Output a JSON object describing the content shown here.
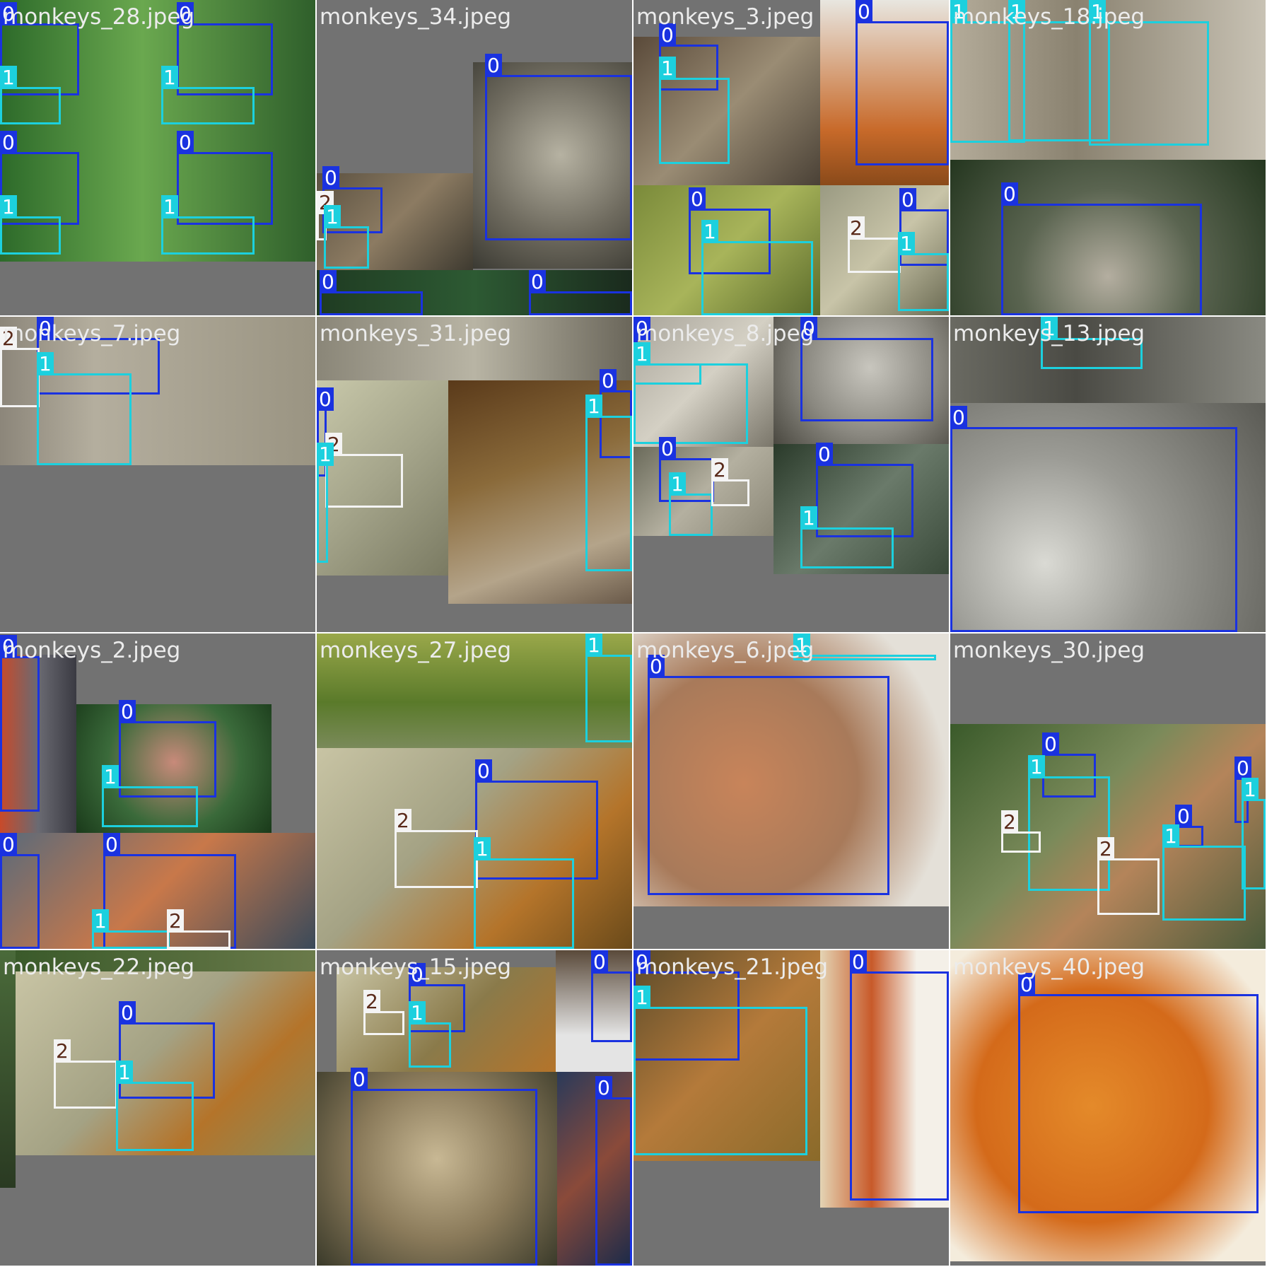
{
  "colors": {
    "class_0": "#1a32e0",
    "class_1": "#1cd0de",
    "class_2": "#f4f4f4",
    "background": "#727272",
    "filename_text": "#ececec"
  },
  "tiles": [
    {
      "filename": "monkeys_28.jpeg",
      "photos": [
        {
          "r": [
            0,
            0,
            446,
            370
          ],
          "bg": "linear-gradient(90deg,#2d6a2a,#6aa84f 45%,#2f5f2b)"
        }
      ],
      "boxes": [
        {
          "c": 0,
          "r": [
            0,
            33,
            112,
            135
          ]
        },
        {
          "c": 1,
          "r": [
            0,
            123,
            86,
            176
          ]
        },
        {
          "c": 0,
          "r": [
            250,
            33,
            386,
            135
          ]
        },
        {
          "c": 1,
          "r": [
            228,
            123,
            360,
            176
          ]
        },
        {
          "c": 0,
          "r": [
            0,
            215,
            112,
            318
          ]
        },
        {
          "c": 1,
          "r": [
            0,
            306,
            86,
            360
          ]
        },
        {
          "c": 0,
          "r": [
            250,
            215,
            386,
            318
          ]
        },
        {
          "c": 1,
          "r": [
            228,
            306,
            360,
            360
          ]
        }
      ]
    },
    {
      "filename": "monkeys_34.jpeg",
      "photos": [
        {
          "r": [
            221,
            88,
            446,
            380
          ],
          "bg": "radial-gradient(circle at 55% 45%,#b6b2a2,#6f6b5f 55%,#3b3a33)"
        },
        {
          "r": [
            0,
            245,
            221,
            382
          ],
          "bg": "linear-gradient(135deg,#5b5141,#8c7b62,#3e3a30)"
        },
        {
          "r": [
            0,
            382,
            446,
            446
          ],
          "bg": "linear-gradient(90deg,#1f3b22,#2d5a33,#1a2a1d)"
        }
      ],
      "boxes": [
        {
          "c": 0,
          "r": [
            238,
            106,
            446,
            340
          ]
        },
        {
          "c": 0,
          "r": [
            8,
            265,
            93,
            330
          ]
        },
        {
          "c": 2,
          "r": [
            0,
            300,
            14,
            340
          ]
        },
        {
          "c": 1,
          "r": [
            10,
            320,
            74,
            380
          ]
        },
        {
          "c": 0,
          "r": [
            4,
            412,
            150,
            446
          ]
        },
        {
          "c": 0,
          "r": [
            300,
            412,
            446,
            446
          ]
        }
      ]
    },
    {
      "filename": "monkeys_3.jpeg",
      "photos": [
        {
          "r": [
            0,
            52,
            264,
            262
          ],
          "bg": "linear-gradient(135deg,#5a4a3a,#9a8c74 50%,#4a4136)"
        },
        {
          "r": [
            264,
            0,
            446,
            262
          ],
          "bg": "linear-gradient(180deg,#e8e6e0,#c86a2a 70%,#8a4a1a)"
        },
        {
          "r": [
            0,
            262,
            264,
            446
          ],
          "bg": "linear-gradient(135deg,#7a8a3a,#a8b45a,#5a6a2a)"
        },
        {
          "r": [
            264,
            262,
            446,
            446
          ],
          "bg": "linear-gradient(135deg,#9a9a82,#c8c4a8,#6a6a52)"
        }
      ],
      "boxes": [
        {
          "c": 0,
          "r": [
            36,
            63,
            120,
            128
          ]
        },
        {
          "c": 1,
          "r": [
            36,
            110,
            136,
            232
          ]
        },
        {
          "c": 0,
          "r": [
            314,
            4,
            446,
            234
          ]
        },
        {
          "c": 0,
          "r": [
            78,
            295,
            194,
            388
          ]
        },
        {
          "c": 1,
          "r": [
            96,
            341,
            254,
            446
          ]
        },
        {
          "c": 2,
          "r": [
            303,
            336,
            378,
            386
          ]
        },
        {
          "c": 0,
          "r": [
            376,
            296,
            446,
            376
          ]
        },
        {
          "c": 1,
          "r": [
            374,
            358,
            446,
            440
          ]
        }
      ]
    },
    {
      "filename": "monkeys_18.jpeg",
      "photos": [
        {
          "r": [
            0,
            0,
            446,
            226
          ],
          "bg": "linear-gradient(90deg,#b4ac9a,#8a8270 40%,#c8c2b4)"
        },
        {
          "r": [
            0,
            226,
            446,
            446
          ],
          "bg": "radial-gradient(circle at 50% 75%,#b4aea0,#5a6450 45%,#24361f)"
        }
      ],
      "boxes": [
        {
          "c": 1,
          "r": [
            0,
            4,
            106,
            202
          ]
        },
        {
          "c": 1,
          "r": [
            82,
            4,
            226,
            200
          ]
        },
        {
          "c": 1,
          "r": [
            196,
            4,
            366,
            206
          ]
        },
        {
          "c": 0,
          "r": [
            72,
            288,
            356,
            446
          ]
        }
      ]
    },
    {
      "filename": "monkeys_7.jpeg",
      "photos": [
        {
          "r": [
            0,
            0,
            446,
            210
          ],
          "bg": "linear-gradient(90deg,#8c867a,#b4ae9e 30%,#9a9482)"
        }
      ],
      "boxes": [
        {
          "c": 0,
          "r": [
            52,
            0,
            226,
            110
          ]
        },
        {
          "c": 2,
          "r": [
            0,
            44,
            56,
            128
          ]
        },
        {
          "c": 1,
          "r": [
            52,
            80,
            186,
            210
          ]
        }
      ]
    },
    {
      "filename": "monkeys_31.jpeg",
      "photos": [
        {
          "r": [
            0,
            0,
            446,
            90
          ],
          "bg": "linear-gradient(90deg,#8a8678,#b8b4a4,#6a665a)"
        },
        {
          "r": [
            0,
            90,
            186,
            366
          ],
          "bg": "linear-gradient(135deg,#c8c8aa,#a4a48a,#7a7a62)"
        },
        {
          "r": [
            186,
            90,
            446,
            406
          ],
          "bg": "linear-gradient(160deg,#5a3a1a,#8a6a3a 40%,#b4a48a 75%,#6a5a4a)"
        }
      ],
      "boxes": [
        {
          "c": 0,
          "r": [
            0,
            130,
            14,
            226
          ]
        },
        {
          "c": 2,
          "r": [
            12,
            194,
            122,
            270
          ]
        },
        {
          "c": 1,
          "r": [
            0,
            208,
            16,
            348
          ]
        },
        {
          "c": 0,
          "r": [
            400,
            104,
            446,
            200
          ]
        },
        {
          "c": 1,
          "r": [
            380,
            140,
            446,
            360
          ]
        }
      ]
    },
    {
      "filename": "monkeys_8.jpeg",
      "photos": [
        {
          "r": [
            0,
            0,
            198,
            184
          ],
          "bg": "linear-gradient(135deg,#a8a49a,#d4d0c4,#7a766a)"
        },
        {
          "r": [
            198,
            0,
            446,
            180
          ],
          "bg": "radial-gradient(circle at 55% 40%,#c8c6be,#8a8880 55%,#4a4840)"
        },
        {
          "r": [
            0,
            184,
            198,
            310
          ],
          "bg": "linear-gradient(135deg,#6a6a5a,#b4b0a0,#8a8676)"
        },
        {
          "r": [
            198,
            180,
            446,
            364
          ],
          "bg": "linear-gradient(135deg,#2a3a2a,#6a7a6a,#3a4a3a)"
        }
      ],
      "boxes": [
        {
          "c": 0,
          "r": [
            0,
            0,
            6,
            50
          ]
        },
        {
          "c": 0,
          "r": [
            236,
            0,
            424,
            148
          ]
        },
        {
          "c": 1,
          "r": [
            0,
            66,
            96,
            96
          ]
        },
        {
          "c": 1,
          "r": [
            0,
            66,
            162,
            180
          ]
        },
        {
          "c": 0,
          "r": [
            36,
            200,
            114,
            262
          ]
        },
        {
          "c": 1,
          "r": [
            50,
            250,
            112,
            310
          ]
        },
        {
          "c": 2,
          "r": [
            110,
            230,
            164,
            268
          ]
        },
        {
          "c": 0,
          "r": [
            258,
            208,
            396,
            312
          ]
        },
        {
          "c": 1,
          "r": [
            236,
            298,
            368,
            356
          ]
        }
      ]
    },
    {
      "filename": "monkeys_13.jpeg",
      "photos": [
        {
          "r": [
            0,
            0,
            446,
            122
          ],
          "bg": "linear-gradient(90deg,#6a6a62,#4a4a44 40%,#8a8a82)"
        },
        {
          "r": [
            0,
            122,
            446,
            446
          ],
          "bg": "radial-gradient(circle at 30% 70%,#dadad4,#9a9a94 40%,#5a5a54)"
        }
      ],
      "boxes": [
        {
          "c": 1,
          "r": [
            128,
            6,
            272,
            74
          ]
        },
        {
          "c": 0,
          "r": [
            0,
            156,
            406,
            446
          ]
        }
      ]
    },
    {
      "filename": "monkeys_2.jpeg",
      "photos": [
        {
          "r": [
            0,
            30,
            108,
            282
          ],
          "bg": "linear-gradient(90deg,#c84a2a,#6a6a72,#3a3a42)"
        },
        {
          "r": [
            108,
            100,
            384,
            282
          ],
          "bg": "radial-gradient(circle at 50% 45%,#c88a7a,#3a6a3a 55%,#1a3a1a)"
        },
        {
          "r": [
            0,
            282,
            446,
            446
          ],
          "bg": "linear-gradient(135deg,#5a6a7a,#c8784a 50%,#3a4a5a)"
        }
      ],
      "boxes": [
        {
          "c": 0,
          "r": [
            0,
            32,
            56,
            252
          ]
        },
        {
          "c": 0,
          "r": [
            168,
            124,
            306,
            232
          ]
        },
        {
          "c": 1,
          "r": [
            144,
            216,
            280,
            274
          ]
        },
        {
          "c": 0,
          "r": [
            0,
            312,
            56,
            446
          ]
        },
        {
          "c": 0,
          "r": [
            146,
            312,
            334,
            446
          ]
        },
        {
          "c": 1,
          "r": [
            130,
            420,
            240,
            446
          ]
        },
        {
          "c": 2,
          "r": [
            236,
            420,
            326,
            446
          ]
        }
      ]
    },
    {
      "filename": "monkeys_27.jpeg",
      "photos": [
        {
          "r": [
            0,
            0,
            446,
            162
          ],
          "bg": "linear-gradient(180deg,#9aa84a,#5a7a2a 60%,#7a8a5a)"
        },
        {
          "r": [
            0,
            162,
            446,
            446
          ],
          "bg": "linear-gradient(135deg,#c8c4a4,#a4a284 40%,#b4742a 70%,#6a4a1a)"
        }
      ],
      "boxes": [
        {
          "c": 1,
          "r": [
            380,
            0,
            446,
            154
          ]
        },
        {
          "c": 0,
          "r": [
            224,
            208,
            398,
            348
          ]
        },
        {
          "c": 2,
          "r": [
            110,
            278,
            228,
            360
          ]
        },
        {
          "c": 1,
          "r": [
            222,
            318,
            364,
            446
          ]
        }
      ]
    },
    {
      "filename": "monkeys_6.jpeg",
      "photos": [
        {
          "r": [
            0,
            0,
            446,
            386
          ],
          "bg": "radial-gradient(circle at 35% 55%,#c8845a,#a87a5a 45%,#e4e0d8 80%)"
        }
      ],
      "boxes": [
        {
          "c": 1,
          "r": [
            226,
            0,
            428,
            38
          ]
        },
        {
          "c": 0,
          "r": [
            20,
            60,
            362,
            370
          ]
        }
      ]
    },
    {
      "filename": "monkeys_30.jpeg",
      "photos": [
        {
          "r": [
            0,
            128,
            446,
            446
          ],
          "bg": "linear-gradient(135deg,#3a5a2a,#7a8a5a 40%,#b4845a 60%,#4a5a3a)"
        }
      ],
      "boxes": [
        {
          "c": 0,
          "r": [
            130,
            170,
            206,
            232
          ]
        },
        {
          "c": 1,
          "r": [
            110,
            202,
            226,
            364
          ]
        },
        {
          "c": 2,
          "r": [
            72,
            280,
            128,
            310
          ]
        },
        {
          "c": 2,
          "r": [
            208,
            318,
            296,
            398
          ]
        },
        {
          "c": 0,
          "r": [
            402,
            204,
            422,
            268
          ]
        },
        {
          "c": 1,
          "r": [
            412,
            234,
            446,
            362
          ]
        },
        {
          "c": 0,
          "r": [
            318,
            272,
            358,
            302
          ]
        },
        {
          "c": 1,
          "r": [
            300,
            300,
            418,
            406
          ]
        }
      ]
    },
    {
      "filename": "monkeys_22.jpeg",
      "photos": [
        {
          "r": [
            0,
            0,
            22,
            336
          ],
          "bg": "linear-gradient(180deg,#4a6a3a,#2a3a22)"
        },
        {
          "r": [
            22,
            30,
            446,
            290
          ],
          "bg": "linear-gradient(135deg,#c8c4a4,#a4a284 45%,#b4742a 70%,#8a8a5a)"
        },
        {
          "r": [
            22,
            0,
            446,
            30
          ],
          "bg": "linear-gradient(90deg,#3a5a2a,#6a7a4a)"
        }
      ],
      "boxes": [
        {
          "c": 0,
          "r": [
            168,
            102,
            304,
            210
          ]
        },
        {
          "c": 2,
          "r": [
            76,
            156,
            166,
            224
          ]
        },
        {
          "c": 1,
          "r": [
            164,
            186,
            274,
            284
          ]
        }
      ]
    },
    {
      "filename": "monkeys_15.jpeg",
      "photos": [
        {
          "r": [
            28,
            24,
            338,
            172
          ],
          "bg": "linear-gradient(135deg,#c8c4a4,#8a7a4a 55%,#b4742a)"
        },
        {
          "r": [
            338,
            0,
            446,
            172
          ],
          "bg": "linear-gradient(180deg,#5a4a3a,#e4e4e4 70%)"
        },
        {
          "r": [
            0,
            172,
            340,
            446
          ],
          "bg": "radial-gradient(circle at 50% 45%,#c8b894,#8a7a5a 50%,#3a3a2a)"
        },
        {
          "r": [
            340,
            172,
            446,
            446
          ],
          "bg": "linear-gradient(135deg,#2a3a5a,#8a4a3a,#1a2a4a)"
        }
      ],
      "boxes": [
        {
          "c": 0,
          "r": [
            130,
            48,
            210,
            116
          ]
        },
        {
          "c": 2,
          "r": [
            66,
            86,
            124,
            120
          ]
        },
        {
          "c": 1,
          "r": [
            130,
            102,
            190,
            166
          ]
        },
        {
          "c": 0,
          "r": [
            388,
            16,
            446,
            130
          ]
        },
        {
          "c": 0,
          "r": [
            48,
            196,
            312,
            446
          ]
        },
        {
          "c": 0,
          "r": [
            394,
            208,
            446,
            446
          ]
        }
      ]
    },
    {
      "filename": "monkeys_21.jpeg",
      "photos": [
        {
          "r": [
            0,
            0,
            264,
            298
          ],
          "bg": "linear-gradient(135deg,#5a4a2a,#b47a3a 50%,#8a6a2a)"
        },
        {
          "r": [
            264,
            0,
            446,
            364
          ],
          "bg": "linear-gradient(90deg,#e4d4b4,#c85a2a 40%,#f4f0e8 75%)"
        }
      ],
      "boxes": [
        {
          "c": 0,
          "r": [
            0,
            0,
            150,
            156
          ]
        },
        {
          "c": 1,
          "r": [
            0,
            80,
            246,
            290
          ]
        },
        {
          "c": 0,
          "r": [
            306,
            0,
            446,
            354
          ]
        }
      ]
    },
    {
      "filename": "monkeys_40.jpeg",
      "photos": [
        {
          "r": [
            0,
            0,
            446,
            440
          ],
          "bg": "radial-gradient(circle at 45% 50%,#e48a2a,#d46a1a 50%,#f4ecdc 85%)"
        }
      ],
      "boxes": [
        {
          "c": 0,
          "r": [
            96,
            62,
            436,
            372
          ]
        }
      ]
    }
  ]
}
